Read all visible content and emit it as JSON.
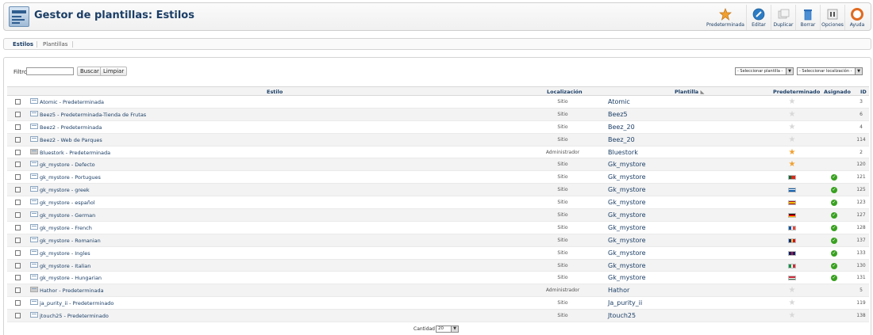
{
  "header": {
    "title": "Gestor de plantillas: Estilos",
    "toolbar": [
      {
        "name": "default",
        "label": "Predeterminada"
      },
      {
        "name": "edit",
        "label": "Editar"
      },
      {
        "name": "duplicate",
        "label": "Duplicar"
      },
      {
        "name": "delete",
        "label": "Borrar"
      },
      {
        "name": "options",
        "label": "Opciones"
      },
      {
        "name": "help",
        "label": "Ayuda"
      }
    ]
  },
  "subnav": {
    "tabs": [
      "Estilos",
      "Plantillas"
    ]
  },
  "filter": {
    "label": "Filtro:",
    "value": "",
    "search_button": "Buscar",
    "clear_button": "Limpiar",
    "template_select": "- Seleccionar plantilla -",
    "location_select": "- Seleccionar localización -"
  },
  "columns": {
    "style": "Estilo",
    "location": "Localización",
    "template": "Plantilla",
    "default": "Predeterminado",
    "assigned": "Asignado",
    "id": "ID"
  },
  "rows": [
    {
      "style": "Atomic - Predeterminada",
      "location": "Sitio",
      "template": "Atomic",
      "default": "star-off",
      "assigned": false,
      "id": "3"
    },
    {
      "style": "Beez5 - Predeterminada-Tienda de Frutas",
      "location": "Sitio",
      "template": "Beez5",
      "default": "star-off",
      "assigned": false,
      "id": "6"
    },
    {
      "style": "Beez2 - Predeterminada",
      "location": "Sitio",
      "template": "Beez_20",
      "default": "star-off",
      "assigned": false,
      "id": "4"
    },
    {
      "style": "Beez2 - Web de Parques",
      "location": "Sitio",
      "template": "Beez_20",
      "default": "star-off",
      "assigned": false,
      "id": "114"
    },
    {
      "style": "Bluestork - Predeterminada",
      "location": "Administrador",
      "template": "Bluestork",
      "default": "star-on",
      "assigned": false,
      "id": "2"
    },
    {
      "style": "gk_mystore - Defecto",
      "location": "Sitio",
      "template": "Gk_mystore",
      "default": "star-on",
      "assigned": false,
      "id": "120"
    },
    {
      "style": "gk_mystore - Portugues",
      "location": "Sitio",
      "template": "Gk_mystore",
      "default": "flag-pt",
      "assigned": true,
      "id": "121"
    },
    {
      "style": "gk_mystore - greek",
      "location": "Sitio",
      "template": "Gk_mystore",
      "default": "flag-gr",
      "assigned": true,
      "id": "125"
    },
    {
      "style": "gk_mystore - español",
      "location": "Sitio",
      "template": "Gk_mystore",
      "default": "flag-es",
      "assigned": true,
      "id": "123"
    },
    {
      "style": "gk_mystore - German",
      "location": "Sitio",
      "template": "Gk_mystore",
      "default": "flag-de",
      "assigned": true,
      "id": "127"
    },
    {
      "style": "gk_mystore - French",
      "location": "Sitio",
      "template": "Gk_mystore",
      "default": "flag-fr",
      "assigned": true,
      "id": "128"
    },
    {
      "style": "gk_mystore - Romanian",
      "location": "Sitio",
      "template": "Gk_mystore",
      "default": "flag-ro",
      "assigned": true,
      "id": "137"
    },
    {
      "style": "gk_mystore - Ingles",
      "location": "Sitio",
      "template": "Gk_mystore",
      "default": "flag-gb",
      "assigned": true,
      "id": "133"
    },
    {
      "style": "gk_mystore - Italian",
      "location": "Sitio",
      "template": "Gk_mystore",
      "default": "flag-it",
      "assigned": true,
      "id": "130"
    },
    {
      "style": "gk_mystore - Hungarian",
      "location": "Sitio",
      "template": "Gk_mystore",
      "default": "flag-hu",
      "assigned": true,
      "id": "131"
    },
    {
      "style": "Hathor - Predeterminada",
      "location": "Administrador",
      "template": "Hathor",
      "default": "star-off",
      "assigned": false,
      "id": "5"
    },
    {
      "style": "ja_purity_ii - Predeterminado",
      "location": "Sitio",
      "template": "Ja_purity_ii",
      "default": "star-off",
      "assigned": false,
      "id": "119"
    },
    {
      "style": "jtouch25 - Predeterminado",
      "location": "Sitio",
      "template": "Jtouch25",
      "default": "star-off",
      "assigned": false,
      "id": "138"
    }
  ],
  "footer": {
    "quantity_label": "Cantidad",
    "quantity_value": "20"
  }
}
